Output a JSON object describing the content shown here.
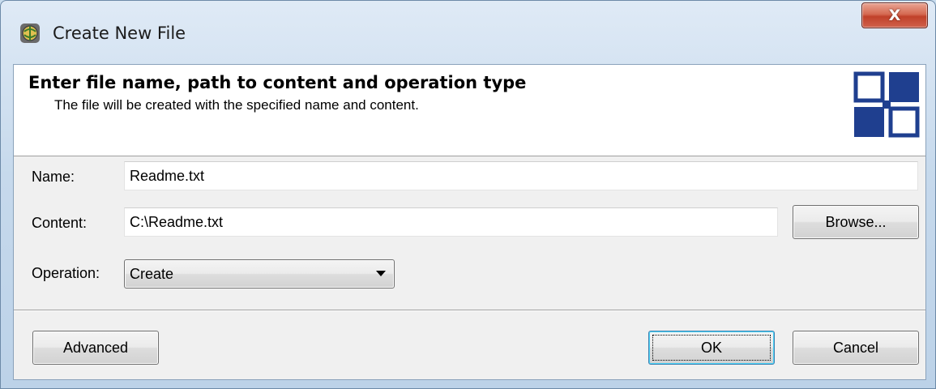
{
  "window": {
    "title": "Create New File",
    "close_label": "X"
  },
  "header": {
    "title": "Enter file name, path to content and operation type",
    "subtitle": "The file will be created with the specified name and content."
  },
  "form": {
    "name_label": "Name:",
    "name_value": "Readme.txt",
    "content_label": "Content:",
    "content_value": "C:\\Readme.txt",
    "browse_label": "Browse...",
    "operation_label": "Operation:",
    "operation_value": "Create"
  },
  "footer": {
    "advanced_label": "Advanced",
    "ok_label": "OK",
    "cancel_label": "Cancel"
  },
  "icons": {
    "title_icon": "app-globe-icon",
    "header_logo": "blue-squares-logo"
  },
  "colors": {
    "logo_blue": "#1f3f8f",
    "close_red": "#c7472f"
  }
}
